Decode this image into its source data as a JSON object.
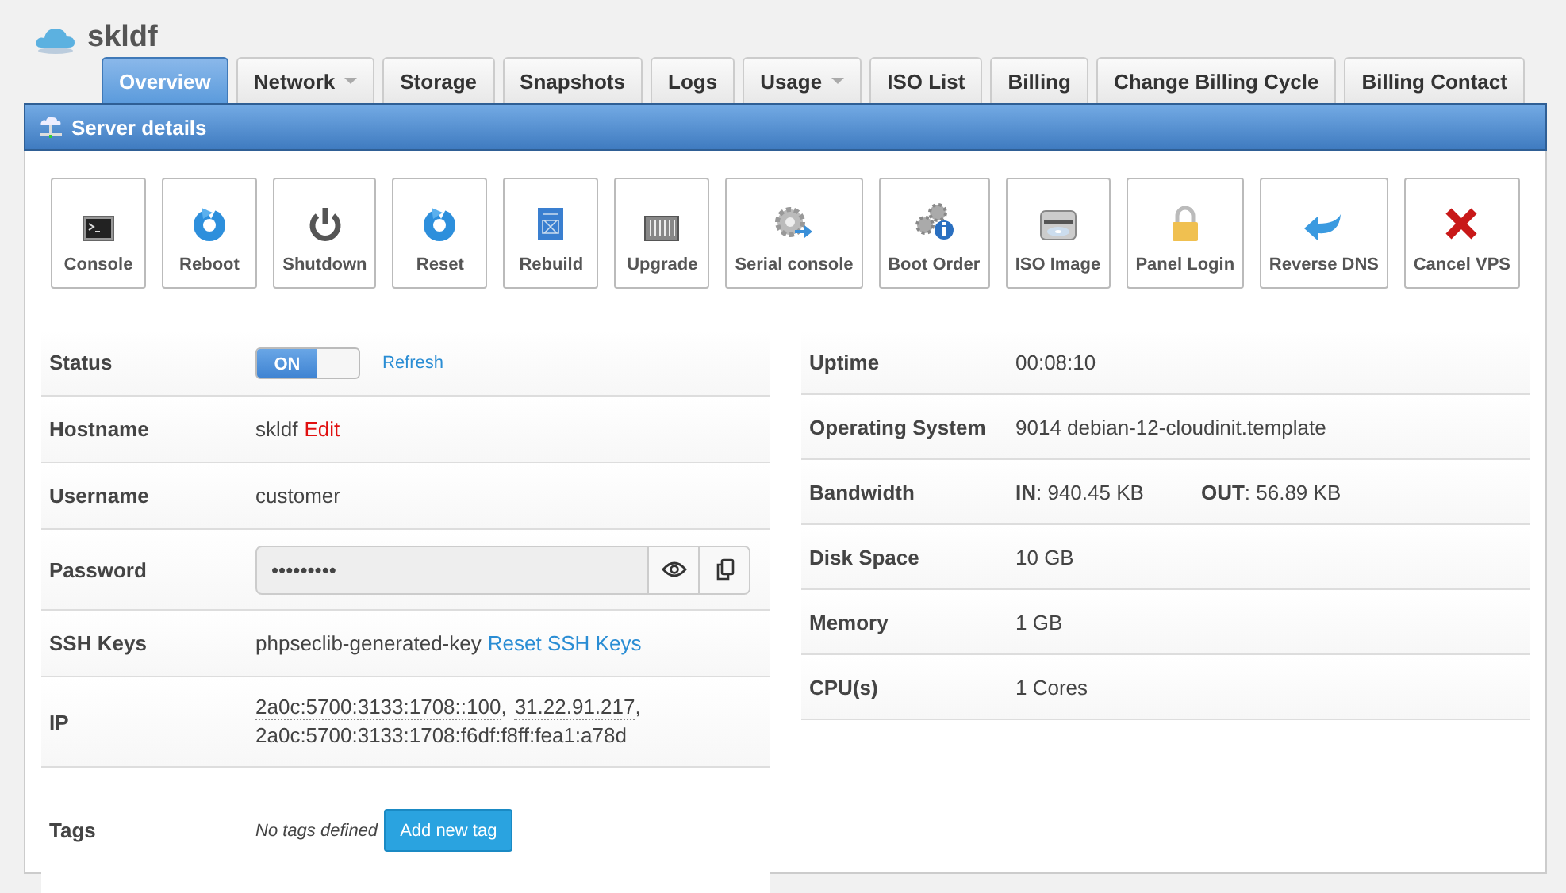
{
  "title": "skldf",
  "tabs": [
    {
      "label": "Overview",
      "selected": true,
      "dropdown": false
    },
    {
      "label": "Network",
      "selected": false,
      "dropdown": true
    },
    {
      "label": "Storage",
      "selected": false,
      "dropdown": false
    },
    {
      "label": "Snapshots",
      "selected": false,
      "dropdown": false
    },
    {
      "label": "Logs",
      "selected": false,
      "dropdown": false
    },
    {
      "label": "Usage",
      "selected": false,
      "dropdown": true
    },
    {
      "label": "ISO List",
      "selected": false,
      "dropdown": false
    },
    {
      "label": "Billing",
      "selected": false,
      "dropdown": false
    },
    {
      "label": "Change Billing Cycle",
      "selected": false,
      "dropdown": false
    },
    {
      "label": "Billing Contact",
      "selected": false,
      "dropdown": false
    }
  ],
  "panel": {
    "title": "Server details"
  },
  "actions": [
    {
      "label": "Console",
      "kind": "console"
    },
    {
      "label": "Reboot",
      "kind": "reboot"
    },
    {
      "label": "Shutdown",
      "kind": "shutdown"
    },
    {
      "label": "Reset",
      "kind": "reset"
    },
    {
      "label": "Rebuild",
      "kind": "rebuild"
    },
    {
      "label": "Upgrade",
      "kind": "upgrade"
    },
    {
      "label": "Serial console",
      "kind": "serial"
    },
    {
      "label": "Boot Order",
      "kind": "boot"
    },
    {
      "label": "ISO Image",
      "kind": "iso"
    },
    {
      "label": "Panel Login",
      "kind": "login"
    },
    {
      "label": "Reverse DNS",
      "kind": "rdns"
    },
    {
      "label": "Cancel VPS",
      "kind": "cancel"
    }
  ],
  "details_left": [
    {
      "label": "Status",
      "kind": "status",
      "switch": {
        "label": "ON",
        "on": true
      },
      "link": "Refresh"
    },
    {
      "label": "Hostname",
      "kind": "text",
      "value": "skldf",
      "link": "Edit"
    },
    {
      "label": "Username",
      "kind": "text",
      "value": "customer"
    },
    {
      "label": "Password",
      "kind": "password",
      "value": "•••••••••"
    },
    {
      "label": "SSH Keys",
      "kind": "text",
      "value": "phpseclib-generated-key",
      "link": "Reset SSH Keys"
    },
    {
      "label": "IP",
      "kind": "ip",
      "addresses": [
        {
          "address": "2a0c:5700:3133:1708::100",
          "suffix": ",",
          "dotted": true
        },
        {
          "address": "31.22.91.217",
          "suffix": ",",
          "dotted": true
        },
        {
          "address": "2a0c:5700:3133:1708:f6df:f8ff:fea1:a78d",
          "dotted": false
        }
      ]
    },
    {
      "label": "Tags",
      "kind": "tags",
      "placeholder": "No tags defined",
      "button": "Add new tag"
    }
  ],
  "details_right": [
    {
      "label": "Uptime",
      "value": "00:08:10"
    },
    {
      "label": "Operating System",
      "value": "9014 debian-12-cloudinit.template"
    },
    {
      "label": "Bandwidth",
      "parts": [
        "**IN**: 940.45 KB",
        "**OUT**: 56.89 KB"
      ]
    },
    {
      "label": "Disk Space",
      "value": "10 GB"
    },
    {
      "label": "Memory",
      "value": "1 GB"
    },
    {
      "label": "CPU(s)",
      "value": "1 Cores"
    }
  ]
}
